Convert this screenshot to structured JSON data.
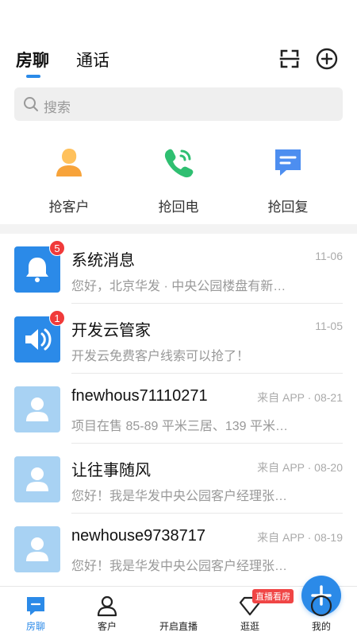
{
  "header": {
    "tabs": [
      {
        "label": "房聊",
        "active": true
      },
      {
        "label": "通话",
        "active": false
      }
    ],
    "icons": [
      "scan-icon",
      "add-circle-icon"
    ]
  },
  "search": {
    "placeholder": "搜索"
  },
  "quick_actions": [
    {
      "label": "抢客户",
      "icon": "customer-icon",
      "color": "#f7a33a"
    },
    {
      "label": "抢回电",
      "icon": "phone-callback-icon",
      "color": "#2fbf71"
    },
    {
      "label": "抢回复",
      "icon": "reply-message-icon",
      "color": "#4d8ef0"
    }
  ],
  "messages": [
    {
      "name": "系统消息",
      "meta": "11-06",
      "preview": "您好，北京华发 · 中央公园楼盘有新…",
      "badge": "5",
      "icon": "bell-icon"
    },
    {
      "name": "开发云管家",
      "meta": "11-05",
      "preview": "开发云免费客户线索可以抢了！",
      "badge": "1",
      "icon": "speaker-icon"
    },
    {
      "name": "fnewhous71110271",
      "meta": "来自 APP · 08-21",
      "preview": "项目在售 85-89 平米三居、139 平米…",
      "badge": "",
      "icon": "user-avatar-icon"
    },
    {
      "name": "让往事随风",
      "meta": "来自 APP · 08-20",
      "preview": "您好！我是华发中央公园客户经理张…",
      "badge": "",
      "icon": "user-avatar-icon"
    },
    {
      "name": "newhouse9738717",
      "meta": "来自 APP · 08-19",
      "preview": "您好！我是华发中央公园客户经理张…",
      "badge": "",
      "icon": "user-avatar-icon"
    }
  ],
  "bottom_nav": {
    "items": [
      {
        "label": "房聊",
        "active": true,
        "icon": "chat-icon"
      },
      {
        "label": "客户",
        "active": false,
        "icon": "person-icon"
      },
      {
        "label": "开启直播",
        "active": false,
        "icon": "plus-icon"
      },
      {
        "label": "逛逛",
        "active": false,
        "icon": "diamond-icon"
      },
      {
        "label": "我的",
        "active": false,
        "icon": "profile-circle-icon"
      }
    ],
    "live_tag": "直播看房"
  },
  "colors": {
    "accent": "#2b8ae8",
    "badge": "#f03a3a",
    "avatar_light": "#a8d2f3"
  }
}
